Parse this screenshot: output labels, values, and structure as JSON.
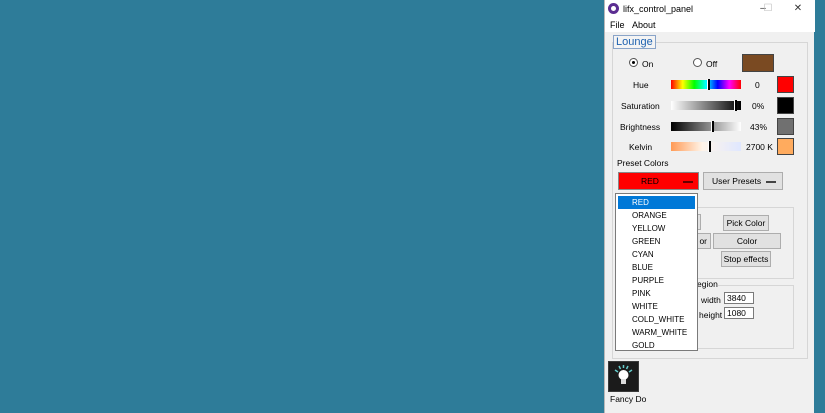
{
  "window": {
    "title": "lifx_control_panel"
  },
  "menu": [
    "File",
    "About"
  ],
  "device": {
    "name": "Lounge"
  },
  "power": {
    "on_label": "On",
    "off_label": "Off",
    "selected": "On",
    "color": "#7a4a22"
  },
  "controls": [
    {
      "label": "Hue",
      "value": "0",
      "swatch": "#ff0000"
    },
    {
      "label": "Saturation",
      "value": "0%",
      "swatch": "#000000"
    },
    {
      "label": "Brightness",
      "value": "43%",
      "swatch": "#707070"
    },
    {
      "label": "Kelvin",
      "value": "2700 K",
      "swatch": "#ffab5e"
    }
  ],
  "preset": {
    "heading": "Preset Colors",
    "selected": "RED",
    "user_presets": "User Presets",
    "options": [
      "RED",
      "ORANGE",
      "YELLOW",
      "GREEN",
      "CYAN",
      "BLUE",
      "PURPLE",
      "PINK",
      "WHITE",
      "COLD_WHITE",
      "WARM_WHITE",
      "GOLD"
    ]
  },
  "tools": {
    "pick_color": "Pick Color",
    "partial_label": "or",
    "color_eyedropper": "Color Eyedropper",
    "stop_effects": "Stop effects"
  },
  "region": {
    "heading_partial": "egion",
    "width_label": "width",
    "width_value": "3840",
    "height_label": "height",
    "height_value": "1080"
  },
  "taskbar": {
    "label": "Fancy Do"
  }
}
